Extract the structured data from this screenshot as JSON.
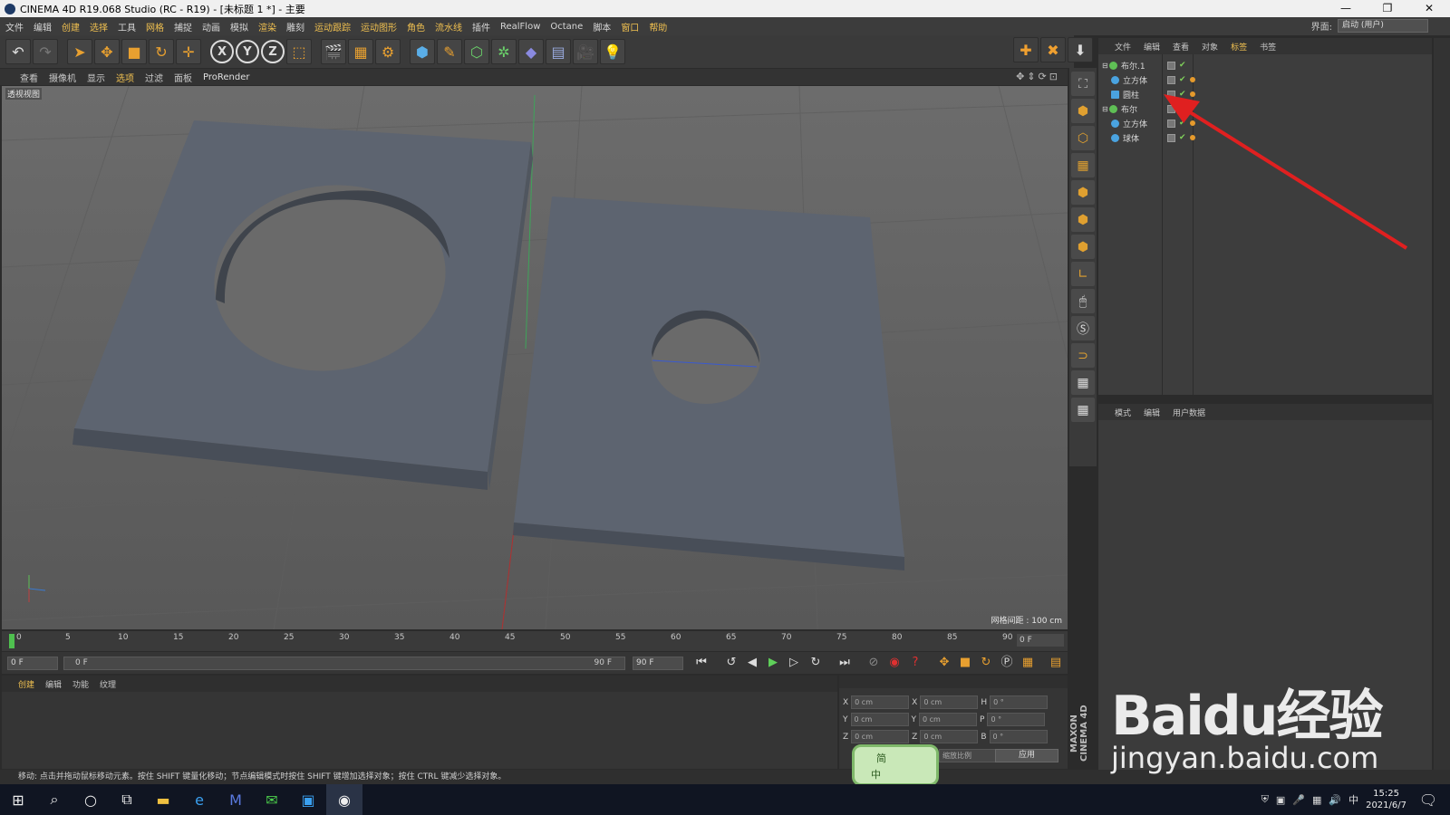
{
  "window": {
    "title": "CINEMA 4D R19.068 Studio (RC - R19) - [未标题 1 *] - 主要",
    "controls": [
      "—",
      "❐",
      "✕"
    ]
  },
  "menubar": {
    "items": [
      "文件",
      "编辑",
      "创建",
      "选择",
      "工具",
      "网格",
      "捕捉",
      "动画",
      "模拟",
      "渲染",
      "雕刻",
      "运动跟踪",
      "运动图形",
      "角色",
      "流水线",
      "插件",
      "RealFlow",
      "Octane",
      "脚本",
      "窗口",
      "帮助"
    ],
    "interface_label": "界面:",
    "interface_value": "启动 (用户)"
  },
  "viewport_menu": {
    "items": [
      "查看",
      "摄像机",
      "显示",
      "选项",
      "过滤",
      "面板",
      "ProRender"
    ]
  },
  "viewport": {
    "label": "透视视图",
    "grid_info": "网格间距 : 100 cm"
  },
  "object_manager": {
    "tabs": [
      "文件",
      "编辑",
      "查看",
      "对象",
      "标签",
      "书签"
    ],
    "rows": [
      {
        "name": "布尔.1",
        "level": 0,
        "color": "#5fbf55"
      },
      {
        "name": "立方体",
        "level": 1,
        "color": "#4aa3e0"
      },
      {
        "name": "圆柱",
        "level": 1,
        "color": "#4aa3e0"
      },
      {
        "name": "布尔",
        "level": 0,
        "color": "#5fbf55"
      },
      {
        "name": "立方体",
        "level": 1,
        "color": "#4aa3e0"
      },
      {
        "name": "球体",
        "level": 1,
        "color": "#4aa3e0"
      }
    ]
  },
  "attribute_manager": {
    "tabs": [
      "模式",
      "编辑",
      "用户数据"
    ]
  },
  "timeline": {
    "ticks": [
      "0",
      "5",
      "10",
      "15",
      "20",
      "25",
      "30",
      "35",
      "40",
      "45",
      "50",
      "55",
      "60",
      "65",
      "70",
      "75",
      "80",
      "85",
      "90"
    ],
    "end_field": "0 F"
  },
  "transport": {
    "start": "0 F",
    "range_start": "0 F",
    "range_end": "90 F",
    "end": "90 F"
  },
  "material_panel": {
    "tabs": [
      "创建",
      "编辑",
      "功能",
      "纹理"
    ]
  },
  "coordinates": {
    "rows": [
      {
        "a": "X",
        "av": "0 cm",
        "b": "X",
        "bv": "0 cm",
        "c": "H",
        "cv": "0 °"
      },
      {
        "a": "Y",
        "av": "0 cm",
        "b": "Y",
        "bv": "0 cm",
        "c": "P",
        "cv": "0 °"
      },
      {
        "a": "Z",
        "av": "0 cm",
        "b": "Z",
        "bv": "0 cm",
        "c": "B",
        "cv": "0 °"
      }
    ],
    "mode": "缩放比例",
    "apply": "应用"
  },
  "statusbar": {
    "text": "移动: 点击并拖动鼠标移动元素。按住 SHIFT 键量化移动；节点编辑模式时按住 SHIFT 键增加选择对象；按住 CTRL 键减少选择对象。"
  },
  "taskbar": {
    "time": "15:25",
    "date": "2021/6/7",
    "ime_lang": "中"
  },
  "ime_widget": {
    "top": "简",
    "bottom": "中"
  },
  "watermark": {
    "line1": "Baidu经验",
    "line2": "jingyan.baidu.com"
  },
  "maxon": "MAXON CINEMA 4D"
}
